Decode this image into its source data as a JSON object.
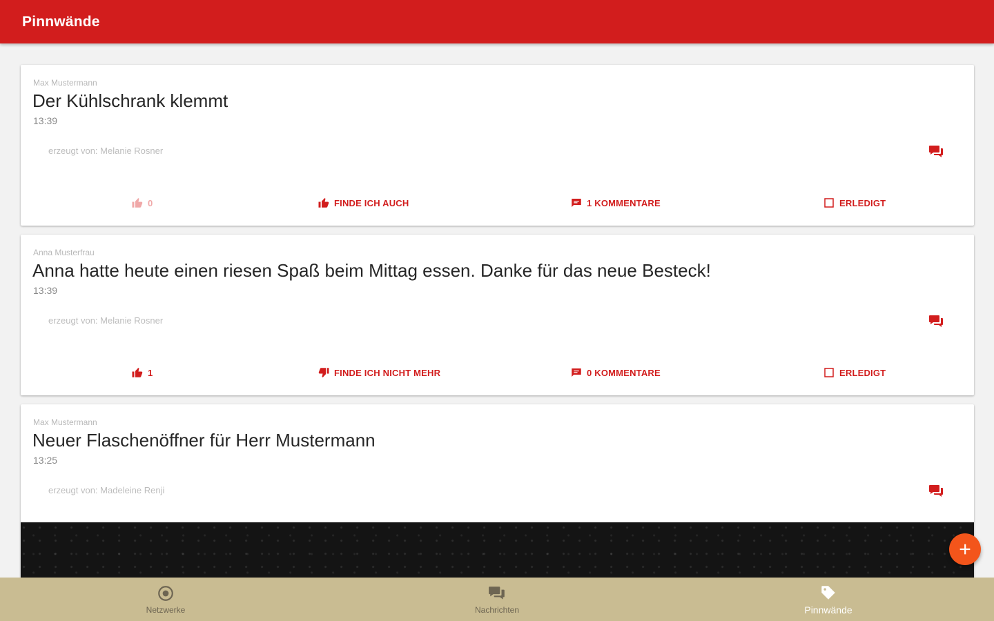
{
  "appbar": {
    "title": "Pinnwände"
  },
  "cards": [
    {
      "author": "Max Mustermann",
      "title": "Der Kühlschrank klemmt",
      "time": "13:39",
      "creator": "erzeugt von: Melanie Rosner",
      "likes": "0",
      "vote_label": "FINDE ICH AUCH",
      "comments_label": "1 KOMMENTARE",
      "done_label": "ERLEDIGT"
    },
    {
      "author": "Anna Musterfrau",
      "title": "Anna hatte heute einen riesen Spaß beim Mittag essen. Danke für das neue Besteck!",
      "time": "13:39",
      "creator": "erzeugt von: Melanie Rosner",
      "likes": "1",
      "vote_label": "FINDE ICH NICHT MEHR",
      "comments_label": "0 KOMMENTARE",
      "done_label": "ERLEDIGT"
    },
    {
      "author": "Max Mustermann",
      "title": "Neuer Flaschenöffner für Herr Mustermann",
      "time": "13:25",
      "creator": "erzeugt von: Madeleine Renji"
    }
  ],
  "fab": {
    "icon": "plus-icon"
  },
  "bottom_nav": [
    {
      "label": "Netzwerke",
      "icon": "network-icon"
    },
    {
      "label": "Nachrichten",
      "icon": "chat-icon"
    },
    {
      "label": "Pinnwände",
      "icon": "tag-icon",
      "active": true
    }
  ],
  "colors": {
    "primary": "#d21d1d",
    "accent": "#f3551b",
    "bottom_nav_bg": "#c9bc92"
  }
}
